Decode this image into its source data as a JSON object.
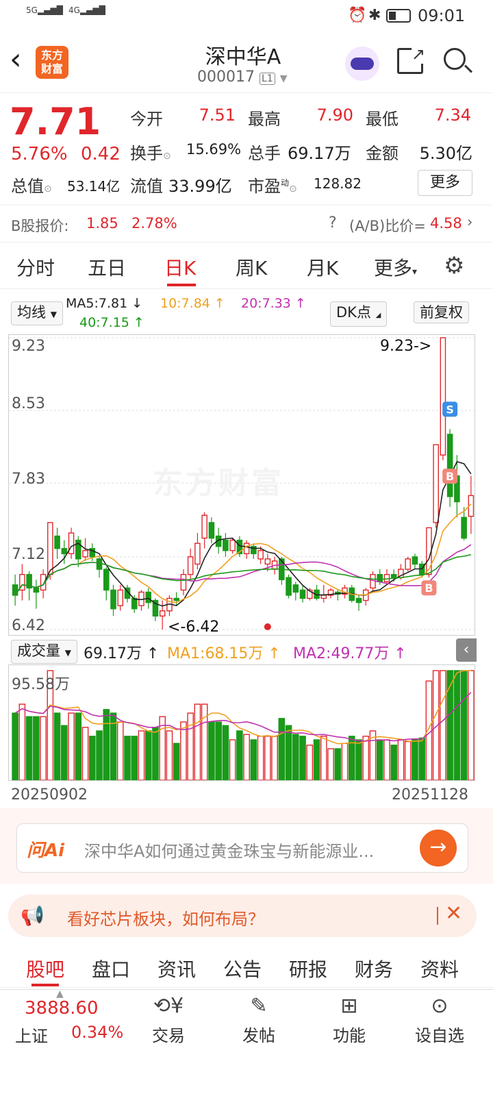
{
  "status_bar": {
    "signal1": "5G",
    "signal2": "4G",
    "time": "09:01"
  },
  "header": {
    "logo_text_line1": "东方",
    "logo_text_line2": "财富",
    "title": "深中华A",
    "code": "000017",
    "level": "L1"
  },
  "quote": {
    "price": "7.71",
    "change_pct": "5.76%",
    "change": "0.42",
    "open_label": "今开",
    "open": "7.51",
    "high_label": "最高",
    "high": "7.90",
    "low_label": "最低",
    "low": "7.34",
    "turnover_label": "换手",
    "turnover": "15.69%",
    "volume_label": "总手",
    "volume": "69.17万",
    "amount_label": "金额",
    "amount": "5.30亿",
    "total_cap_label": "总值",
    "total_cap": "53.14亿",
    "float_cap_label": "流值",
    "float_cap": "33.99亿",
    "pe_label": "市盈",
    "pe_sup": "动",
    "pe": "128.82",
    "more_button": "更多"
  },
  "b_share": {
    "label": "B股报价:",
    "price": "1.85",
    "pct": "2.78%",
    "ratio_label": "(A/B)比价=",
    "ratio": "4.58"
  },
  "period_tabs": [
    "分时",
    "五日",
    "日K",
    "周K",
    "月K",
    "更多"
  ],
  "ma_bar": {
    "selector": "均线",
    "ma5": "MA5:7.81",
    "ma10": "10:7.84",
    "ma20": "20:7.33",
    "ma40": "40:7.15",
    "dk_button": "DK点",
    "adjust_button": "前复权"
  },
  "kline": {
    "y_labels": [
      "9.23",
      "8.53",
      "7.83",
      "7.12",
      "6.42"
    ],
    "watermark": "东方财富",
    "high_annotation": "9.23->",
    "low_annotation": "<-6.42"
  },
  "volume_bar": {
    "selector": "成交量",
    "vol": "69.17万",
    "ma1": "MA1:68.15万",
    "ma2": "MA2:49.77万",
    "max_label": "95.58万",
    "date_start": "20250902",
    "date_end": "20251128"
  },
  "ai_box": {
    "brand": "问Ai",
    "prompt": "深中华A如何通过黄金珠宝与新能源业..."
  },
  "notice": {
    "text": "看好芯片板块，如何布局？"
  },
  "bottom_tabs": [
    "股吧",
    "盘口",
    "资讯",
    "公告",
    "研报",
    "财务",
    "资料"
  ],
  "bottom_nav": {
    "index_value": "3888.60",
    "index_name": "上证",
    "index_pct": "0.34%",
    "trade": "交易",
    "post": "发帖",
    "function": "功能",
    "watchlist": "设自选"
  },
  "colors": {
    "up": "#e0262b",
    "down": "#1a9a1a",
    "ma5": "#222222",
    "ma10": "#f0a020",
    "ma20": "#c030b0",
    "ma40": "#1a9a1a"
  },
  "chart_data": {
    "type": "candlestick",
    "y_ticks": [
      9.23,
      8.53,
      7.83,
      7.12,
      6.42
    ],
    "ylim": [
      6.42,
      9.23
    ],
    "x_start": "20250902",
    "x_end": "20251128",
    "candles": [
      {
        "o": 6.85,
        "c": 6.75,
        "h": 6.95,
        "l": 6.65
      },
      {
        "o": 6.8,
        "c": 6.95,
        "h": 7.05,
        "l": 6.7
      },
      {
        "o": 6.95,
        "c": 6.82,
        "h": 6.98,
        "l": 6.7
      },
      {
        "o": 6.82,
        "c": 6.78,
        "h": 6.9,
        "l": 6.62
      },
      {
        "o": 6.8,
        "c": 6.95,
        "h": 7.0,
        "l": 6.72
      },
      {
        "o": 6.95,
        "c": 7.45,
        "h": 7.45,
        "l": 6.9
      },
      {
        "o": 7.32,
        "c": 7.2,
        "h": 7.4,
        "l": 7.1
      },
      {
        "o": 7.2,
        "c": 7.15,
        "h": 7.28,
        "l": 7.05
      },
      {
        "o": 7.15,
        "c": 7.35,
        "h": 7.4,
        "l": 7.1
      },
      {
        "o": 7.28,
        "c": 7.1,
        "h": 7.32,
        "l": 7.02
      },
      {
        "o": 7.12,
        "c": 7.18,
        "h": 7.3,
        "l": 7.08
      },
      {
        "o": 7.2,
        "c": 7.12,
        "h": 7.25,
        "l": 7.08
      },
      {
        "o": 7.1,
        "c": 7.0,
        "h": 7.12,
        "l": 6.92
      },
      {
        "o": 7.0,
        "c": 6.8,
        "h": 7.02,
        "l": 6.7
      },
      {
        "o": 6.8,
        "c": 6.62,
        "h": 6.85,
        "l": 6.55
      },
      {
        "o": 6.65,
        "c": 6.8,
        "h": 6.85,
        "l": 6.6
      },
      {
        "o": 6.82,
        "c": 6.72,
        "h": 6.85,
        "l": 6.68
      },
      {
        "o": 6.72,
        "c": 6.62,
        "h": 6.75,
        "l": 6.58
      },
      {
        "o": 6.65,
        "c": 6.78,
        "h": 6.8,
        "l": 6.6
      },
      {
        "o": 6.78,
        "c": 6.68,
        "h": 6.82,
        "l": 6.62
      },
      {
        "o": 6.7,
        "c": 6.55,
        "h": 6.72,
        "l": 6.5
      },
      {
        "o": 6.55,
        "c": 6.6,
        "h": 6.7,
        "l": 6.42
      },
      {
        "o": 6.6,
        "c": 6.72,
        "h": 6.75,
        "l": 6.55
      },
      {
        "o": 6.72,
        "c": 6.7,
        "h": 6.78,
        "l": 6.65
      },
      {
        "o": 6.8,
        "c": 6.95,
        "h": 7.0,
        "l": 6.75
      },
      {
        "o": 6.95,
        "c": 7.12,
        "h": 7.2,
        "l": 6.9
      },
      {
        "o": 7.05,
        "c": 7.25,
        "h": 7.35,
        "l": 7.0
      },
      {
        "o": 7.3,
        "c": 7.52,
        "h": 7.55,
        "l": 7.2
      },
      {
        "o": 7.45,
        "c": 7.3,
        "h": 7.5,
        "l": 7.25
      },
      {
        "o": 7.32,
        "c": 7.22,
        "h": 7.4,
        "l": 7.15
      },
      {
        "o": 7.28,
        "c": 7.18,
        "h": 7.35,
        "l": 7.12
      },
      {
        "o": 7.18,
        "c": 7.28,
        "h": 7.3,
        "l": 7.15
      },
      {
        "o": 7.28,
        "c": 7.15,
        "h": 7.32,
        "l": 7.12
      },
      {
        "o": 7.15,
        "c": 7.25,
        "h": 7.28,
        "l": 7.1
      },
      {
        "o": 7.22,
        "c": 7.15,
        "h": 7.25,
        "l": 7.1
      },
      {
        "o": 7.1,
        "c": 7.18,
        "h": 7.22,
        "l": 7.05
      },
      {
        "o": 7.05,
        "c": 7.1,
        "h": 7.15,
        "l": 6.98
      },
      {
        "o": 7.0,
        "c": 7.08,
        "h": 7.12,
        "l": 6.95
      },
      {
        "o": 7.1,
        "c": 6.9,
        "h": 7.12,
        "l": 6.85
      },
      {
        "o": 6.92,
        "c": 6.75,
        "h": 6.95,
        "l": 6.72
      },
      {
        "o": 6.85,
        "c": 6.78,
        "h": 6.88,
        "l": 6.7
      },
      {
        "o": 6.8,
        "c": 6.72,
        "h": 6.85,
        "l": 6.68
      },
      {
        "o": 6.72,
        "c": 6.8,
        "h": 6.82,
        "l": 6.7
      },
      {
        "o": 6.8,
        "c": 6.72,
        "h": 6.85,
        "l": 6.7
      },
      {
        "o": 6.72,
        "c": 6.75,
        "h": 6.85,
        "l": 6.68
      },
      {
        "o": 6.75,
        "c": 6.8,
        "h": 6.82,
        "l": 6.72
      },
      {
        "o": 6.78,
        "c": 6.76,
        "h": 6.8,
        "l": 6.7
      },
      {
        "o": 6.76,
        "c": 6.82,
        "h": 6.85,
        "l": 6.72
      },
      {
        "o": 6.82,
        "c": 6.7,
        "h": 6.85,
        "l": 6.68
      },
      {
        "o": 6.72,
        "c": 6.68,
        "h": 6.75,
        "l": 6.6
      },
      {
        "o": 6.7,
        "c": 6.8,
        "h": 6.82,
        "l": 6.65
      },
      {
        "o": 6.82,
        "c": 6.95,
        "h": 6.98,
        "l": 6.78
      },
      {
        "o": 6.95,
        "c": 6.88,
        "h": 7.0,
        "l": 6.85
      },
      {
        "o": 6.88,
        "c": 6.95,
        "h": 7.0,
        "l": 6.85
      },
      {
        "o": 6.95,
        "c": 6.92,
        "h": 7.0,
        "l": 6.88
      },
      {
        "o": 6.92,
        "c": 7.0,
        "h": 7.05,
        "l": 6.9
      },
      {
        "o": 7.0,
        "c": 7.1,
        "h": 7.12,
        "l": 6.98
      },
      {
        "o": 7.12,
        "c": 7.05,
        "h": 7.15,
        "l": 7.0
      },
      {
        "o": 7.05,
        "c": 6.95,
        "h": 7.08,
        "l": 6.92
      },
      {
        "o": 6.95,
        "c": 7.4,
        "h": 7.4,
        "l": 6.92
      },
      {
        "o": 7.45,
        "c": 8.2,
        "h": 8.2,
        "l": 7.4
      },
      {
        "o": 8.1,
        "c": 9.23,
        "h": 9.23,
        "l": 8.05
      },
      {
        "o": 8.3,
        "c": 7.7,
        "h": 8.35,
        "l": 7.6
      },
      {
        "o": 7.9,
        "c": 7.65,
        "h": 8.1,
        "l": 7.5
      },
      {
        "o": 7.5,
        "c": 7.3,
        "h": 7.6,
        "l": 7.28
      },
      {
        "o": 7.51,
        "c": 7.71,
        "h": 7.9,
        "l": 7.34
      }
    ],
    "markers": [
      {
        "label": "B",
        "index": 59
      },
      {
        "label": "B",
        "index": 62
      },
      {
        "label": "S",
        "index": 62
      }
    ]
  }
}
